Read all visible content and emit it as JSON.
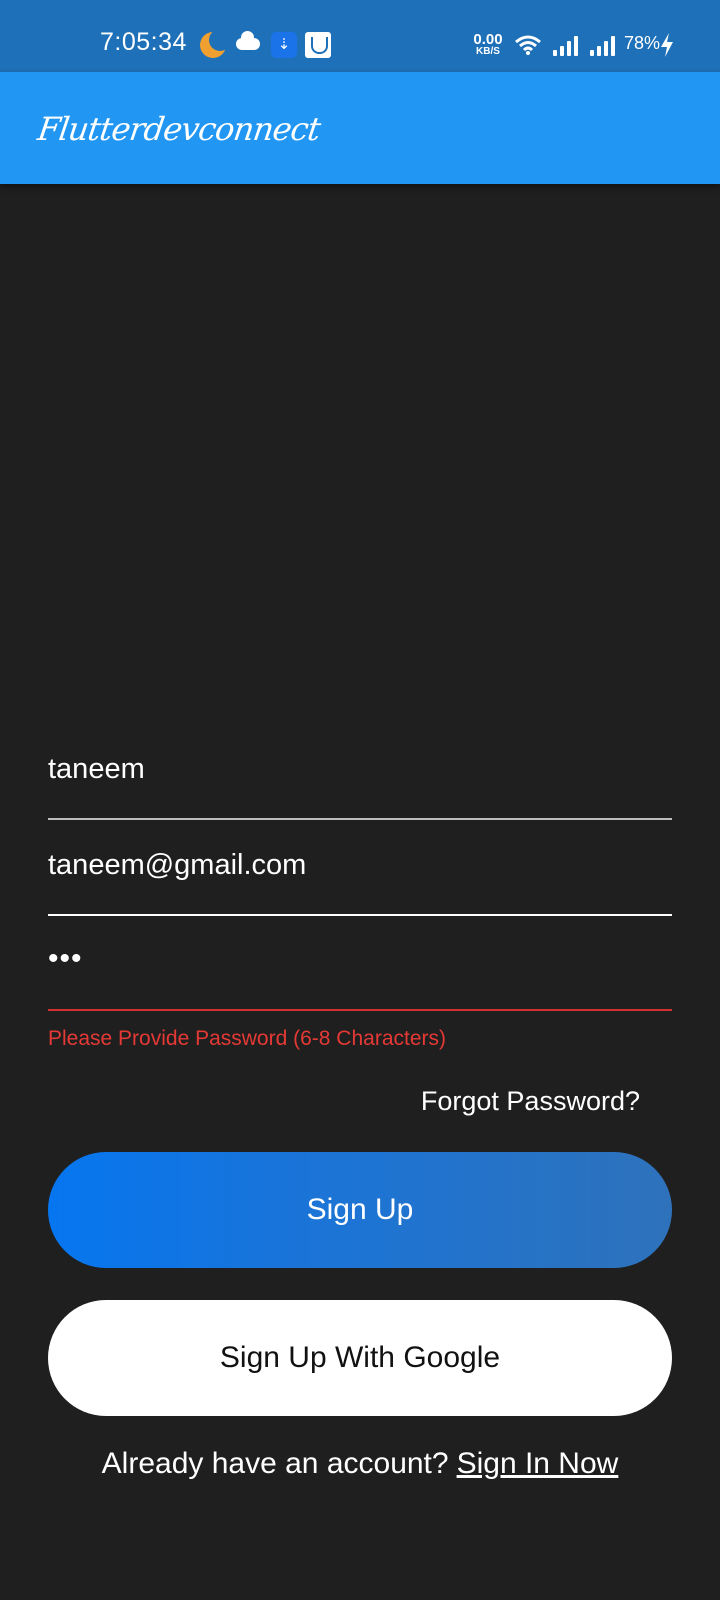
{
  "status_bar": {
    "time": "7:05:34",
    "net_speed_value": "0.00",
    "net_speed_unit": "KB/S",
    "battery": "78%",
    "icons": [
      "moon-icon",
      "cloud-icon",
      "usb-icon",
      "gallery-icon",
      "wifi-icon",
      "signal-icon",
      "signal-icon",
      "charging-icon"
    ]
  },
  "app_bar": {
    "title": "Flutterdevconnect"
  },
  "form": {
    "username_value": "taneem",
    "email_value": "taneem@gmail.com",
    "password_value": "•••",
    "password_error": "Please Provide Password (6-8 Characters)",
    "forgot_password": "Forgot Password?"
  },
  "buttons": {
    "sign_up": "Sign Up",
    "sign_up_google": "Sign Up With Google"
  },
  "footer": {
    "prompt": "Already have an account?",
    "sign_in_link": "Sign In Now"
  },
  "colors": {
    "status_bar": "#1e70b8",
    "app_bar": "#2196f3",
    "background": "#1f1f1f",
    "primary_button": "#0676f0",
    "error": "#e53935"
  }
}
